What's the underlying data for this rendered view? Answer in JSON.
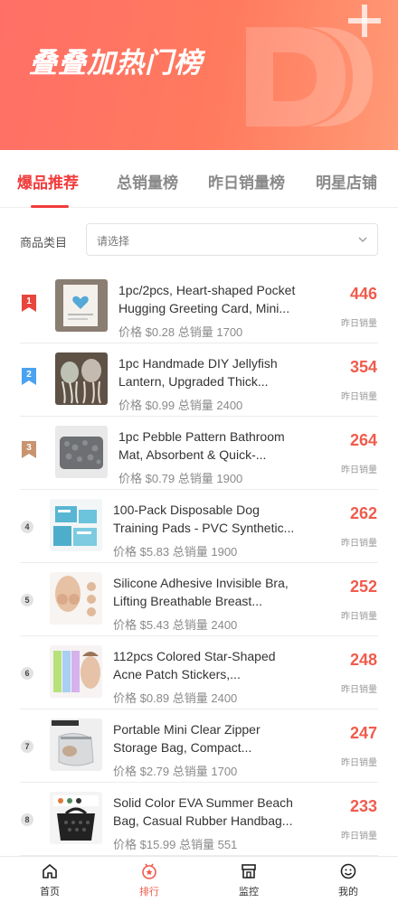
{
  "header": {
    "title": "叠叠加热门榜"
  },
  "tabs": [
    {
      "label": "爆品推荐",
      "active": true
    },
    {
      "label": "总销量榜",
      "active": false
    },
    {
      "label": "昨日销量榜",
      "active": false
    },
    {
      "label": "明星店铺",
      "active": false
    }
  ],
  "filter": {
    "label": "商品类目",
    "placeholder": "请选择"
  },
  "count_label": "昨日销量",
  "items": [
    {
      "rank": "1",
      "title_line1": "1pc/2pcs, Heart-shaped Pocket",
      "title_line2": "Hugging Greeting Card, Mini...",
      "meta": "价格 $0.28 总销量 1700",
      "count": "446",
      "badge_color": "#e8453c"
    },
    {
      "rank": "2",
      "title_line1": "1pc Handmade DIY Jellyfish",
      "title_line2": "Lantern, Upgraded Thick...",
      "meta": "价格 $0.99 总销量 2400",
      "count": "354",
      "badge_color": "#4aa3f0"
    },
    {
      "rank": "3",
      "title_line1": "1pc Pebble Pattern Bathroom",
      "title_line2": "Mat, Absorbent & Quick-...",
      "meta": "价格 $0.79 总销量 1900",
      "count": "264",
      "badge_color": "#c8946e"
    },
    {
      "rank": "4",
      "title_line1": "100-Pack Disposable Dog",
      "title_line2": "Training Pads - PVC Synthetic...",
      "meta": "价格 $5.83 总销量 1900",
      "count": "262"
    },
    {
      "rank": "5",
      "title_line1": "Silicone Adhesive Invisible Bra,",
      "title_line2": "Lifting Breathable Breast...",
      "meta": "价格 $5.43 总销量 2400",
      "count": "252"
    },
    {
      "rank": "6",
      "title_line1": "112pcs Colored Star-Shaped",
      "title_line2": "Acne Patch Stickers,...",
      "meta": "价格 $0.89 总销量 2400",
      "count": "248"
    },
    {
      "rank": "7",
      "title_line1": "Portable Mini Clear Zipper",
      "title_line2": "Storage Bag, Compact...",
      "meta": "价格 $2.79 总销量 1700",
      "count": "247"
    },
    {
      "rank": "8",
      "title_line1": "Solid Color EVA Summer Beach",
      "title_line2": "Bag, Casual Rubber Handbag...",
      "meta": "价格 $15.99 总销量 551",
      "count": "233"
    }
  ],
  "nav": [
    {
      "label": "首页",
      "icon": "home-icon",
      "active": false
    },
    {
      "label": "排行",
      "icon": "ranking-icon",
      "active": true
    },
    {
      "label": "监控",
      "icon": "monitor-icon",
      "active": false
    },
    {
      "label": "我的",
      "icon": "profile-icon",
      "active": false
    }
  ],
  "colors": {
    "accent": "#f23b3b",
    "count": "#f05b4c",
    "header_start": "#ff6f66",
    "header_end": "#ff9a76"
  }
}
